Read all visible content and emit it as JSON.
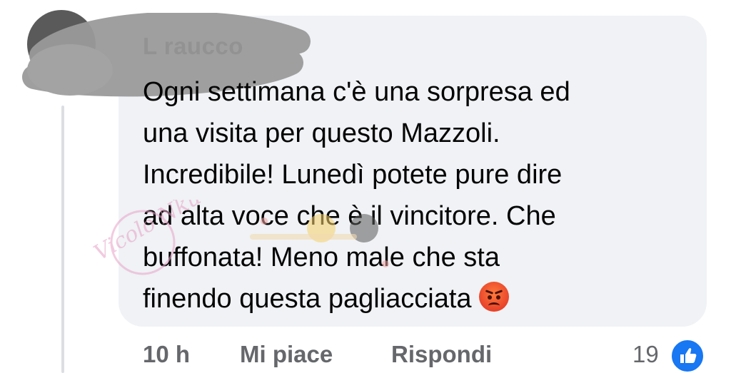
{
  "comment": {
    "author": "L   raucco",
    "lines": [
      "Ogni settimana c'è una sorpresa ed",
      "una visita per questo Mazzoli.",
      "Incredibile! Lunedì potete pure dire",
      "ad alta voce che è il vincitore. Che",
      "buffonata! Meno male che sta",
      "finendo questa pagliacciata"
    ],
    "emoji": "angry-face-icon"
  },
  "actions": {
    "time": "10 h",
    "like_label": "Mi piace",
    "reply_label": "Rispondi",
    "reaction_count": "19",
    "reaction_icon": "like-thumb-icon"
  },
  "watermark": {
    "text": "Vicolo Nku"
  },
  "colors": {
    "bubble": "#f0f2f5",
    "text": "#050505",
    "secondary": "#65676b",
    "like_blue": "#1877f2"
  }
}
